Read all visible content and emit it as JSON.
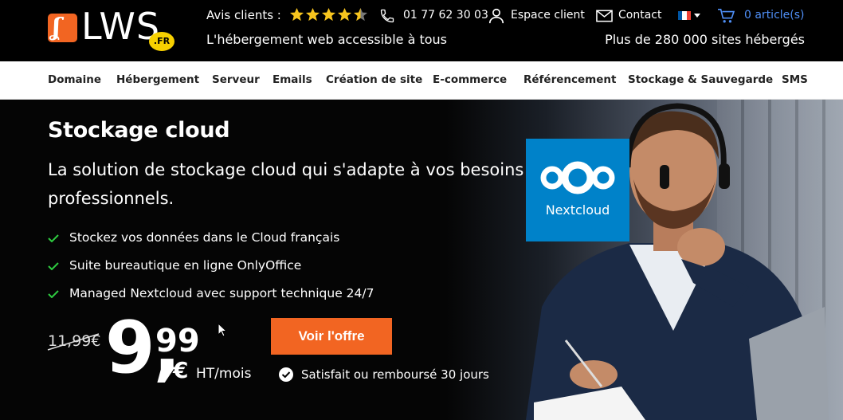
{
  "brand": {
    "logo_letter": "ʆ",
    "logo_word": "LWS",
    "logo_tld": ".FR"
  },
  "header": {
    "avis_label": "Avis clients :",
    "rating": 4.5,
    "rating_max": 5,
    "phone": "01 77 62 30 03",
    "espace_client": "Espace client",
    "contact": "Contact",
    "cart": "0 article(s)",
    "tagline": "L'hébergement web accessible à tous",
    "sites": "Plus de 280 000 sites hébergés"
  },
  "nav": {
    "items": [
      {
        "label": "Domaine"
      },
      {
        "label": "Hébergement"
      },
      {
        "label": "Serveur"
      },
      {
        "label": "Emails"
      },
      {
        "label": "Création de site"
      },
      {
        "label": "E-commerce"
      },
      {
        "label": "Référencement"
      },
      {
        "label": "Stockage & Sauvegarde"
      },
      {
        "label": "SMS"
      }
    ]
  },
  "hero": {
    "title": "Stockage cloud",
    "subtitle": "La solution de stockage cloud qui s'adapte à vos besoins professionnels.",
    "features": [
      "Stockez vos données dans le Cloud français",
      "Suite bureautique en ligne OnlyOffice",
      "Managed Nextcloud avec support technique 24/7"
    ],
    "old_price": "11,99€",
    "price_int": "9,",
    "price_dec": "99",
    "price_currency": "€",
    "price_unit": "HT/mois",
    "cta": "Voir l'offre",
    "guarantee": "Satisfait ou remboursé 30 jours",
    "nextcloud_label": "Nextcloud"
  },
  "colors": {
    "accent": "#f26522",
    "nextcloud_blue": "#0082c9",
    "link_blue": "#4f8ff7",
    "star": "#f7c51e",
    "check": "#2ecc40"
  }
}
